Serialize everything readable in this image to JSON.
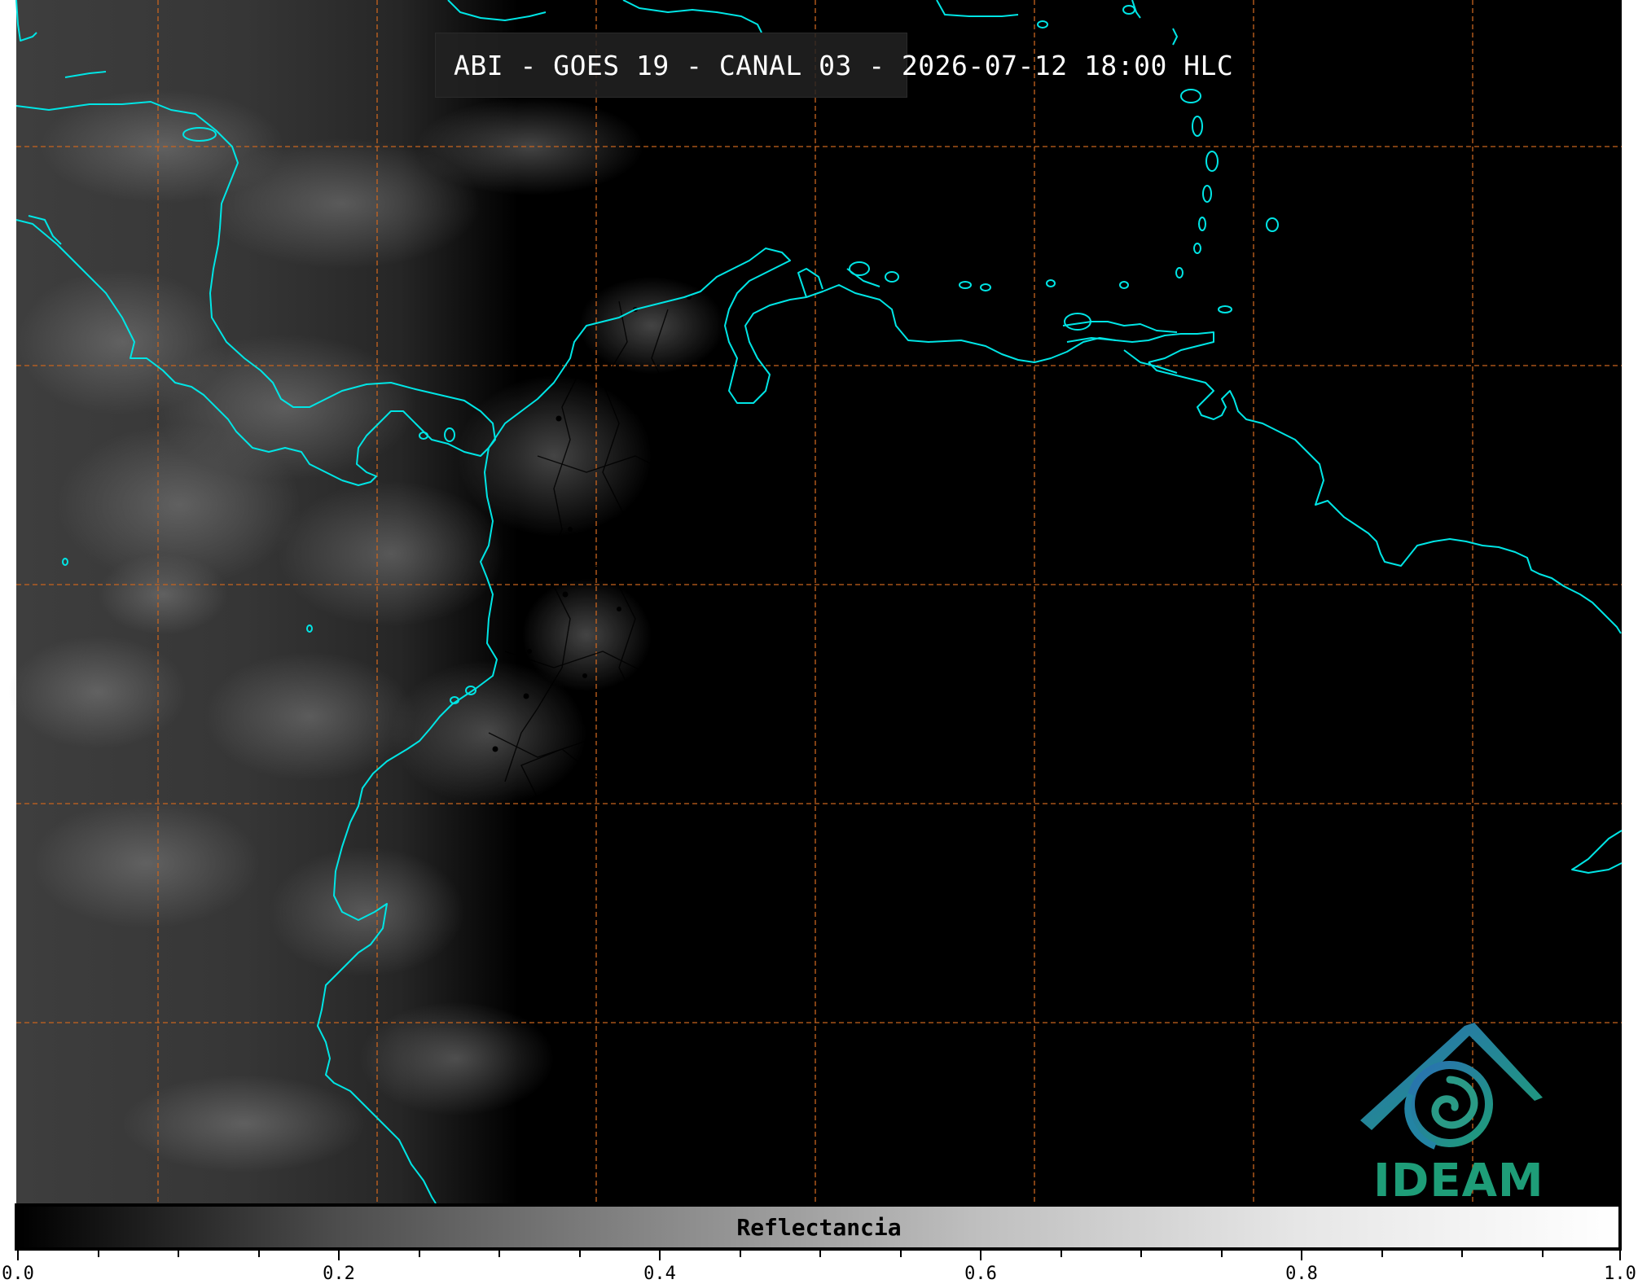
{
  "title": "ABI - GOES 19 - CANAL 03 - 2026-07-12 18:00 HLC",
  "colorbar": {
    "label": "Reflectancia",
    "ticks": [
      "0.0",
      "0.2",
      "0.4",
      "0.6",
      "0.8",
      "1.0"
    ],
    "range": [
      0.0,
      1.0
    ]
  },
  "logo": {
    "text": "IDEAM",
    "icon": "ideam-logo-icon"
  },
  "colors": {
    "coastline": "#00e5e5",
    "gridline": "#c8641e",
    "borders": "#000000",
    "logo_primary": "#1e9d78",
    "logo_secondary": "#2a6fb5"
  }
}
